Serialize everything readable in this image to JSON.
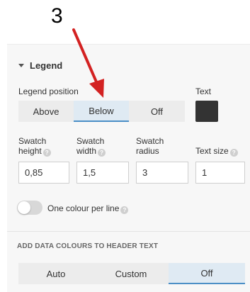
{
  "annotation": {
    "step_number": "3",
    "arrow_color": "#d32222"
  },
  "legend": {
    "title": "Legend",
    "position": {
      "label": "Legend position",
      "options": [
        "Above",
        "Below",
        "Off"
      ],
      "selected": "Below"
    },
    "text": {
      "label": "Text",
      "color": "#333333"
    },
    "swatch_height": {
      "label_line1": "Swatch",
      "label_line2": "height",
      "value": "0,85"
    },
    "swatch_width": {
      "label_line1": "Swatch",
      "label_line2": "width",
      "value": "1,5"
    },
    "swatch_radius": {
      "label_line1": "Swatch",
      "label_line2": "radius",
      "value": "3"
    },
    "text_size": {
      "label": "Text size",
      "value": "1"
    },
    "one_colour_per_line": {
      "label": "One colour per line",
      "enabled": false
    }
  },
  "header_colours": {
    "label": "ADD DATA COLOURS TO HEADER TEXT",
    "options": [
      "Auto",
      "Custom",
      "Off"
    ],
    "selected": "Off"
  },
  "colors": {
    "accent": "#4b8fc6",
    "active_bg": "#dfeaf3",
    "button_bg": "#ececec",
    "panel_bg": "#f7f7f7"
  }
}
